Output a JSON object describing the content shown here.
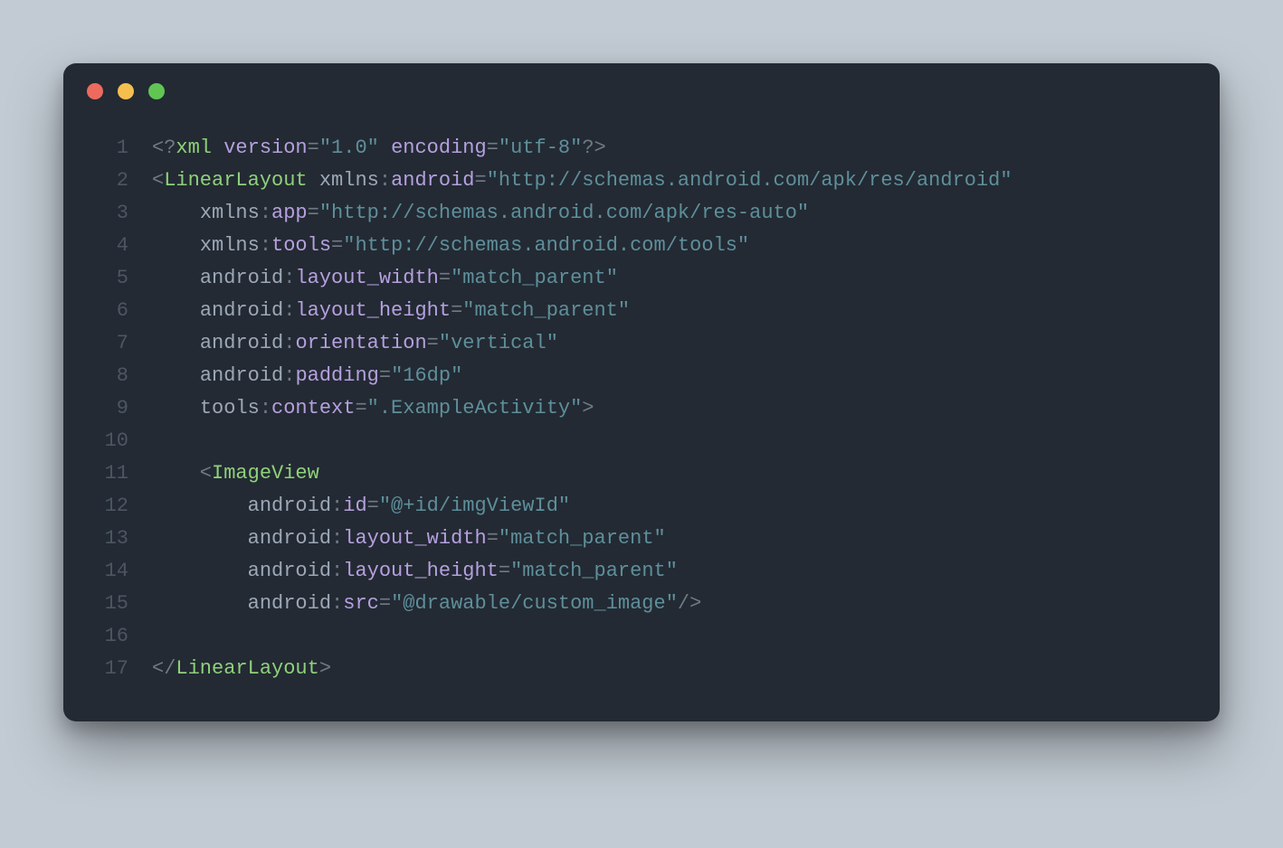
{
  "window": {
    "traffic_lights": [
      "red",
      "yellow",
      "green"
    ]
  },
  "code": {
    "lines": [
      {
        "n": "1",
        "tokens": [
          [
            "punc",
            "<?"
          ],
          [
            "tag",
            "xml"
          ],
          [
            "punc",
            " "
          ],
          [
            "attr",
            "version"
          ],
          [
            "punc",
            "="
          ],
          [
            "str",
            "\"1.0\""
          ],
          [
            "punc",
            " "
          ],
          [
            "attr",
            "encoding"
          ],
          [
            "punc",
            "="
          ],
          [
            "str",
            "\"utf-8\""
          ],
          [
            "punc",
            "?>"
          ]
        ]
      },
      {
        "n": "2",
        "tokens": [
          [
            "punc",
            "<"
          ],
          [
            "tag",
            "LinearLayout"
          ],
          [
            "punc",
            " "
          ],
          [
            "ns",
            "xmlns"
          ],
          [
            "punc",
            ":"
          ],
          [
            "attr",
            "android"
          ],
          [
            "punc",
            "="
          ],
          [
            "str",
            "\"http://schemas.android.com/apk/res/android\""
          ]
        ]
      },
      {
        "n": "3",
        "tokens": [
          [
            "punc",
            "    "
          ],
          [
            "ns",
            "xmlns"
          ],
          [
            "punc",
            ":"
          ],
          [
            "attr",
            "app"
          ],
          [
            "punc",
            "="
          ],
          [
            "str",
            "\"http://schemas.android.com/apk/res-auto\""
          ]
        ]
      },
      {
        "n": "4",
        "tokens": [
          [
            "punc",
            "    "
          ],
          [
            "ns",
            "xmlns"
          ],
          [
            "punc",
            ":"
          ],
          [
            "attr",
            "tools"
          ],
          [
            "punc",
            "="
          ],
          [
            "str",
            "\"http://schemas.android.com/tools\""
          ]
        ]
      },
      {
        "n": "5",
        "tokens": [
          [
            "punc",
            "    "
          ],
          [
            "ns",
            "android"
          ],
          [
            "punc",
            ":"
          ],
          [
            "attr",
            "layout_width"
          ],
          [
            "punc",
            "="
          ],
          [
            "str",
            "\"match_parent\""
          ]
        ]
      },
      {
        "n": "6",
        "tokens": [
          [
            "punc",
            "    "
          ],
          [
            "ns",
            "android"
          ],
          [
            "punc",
            ":"
          ],
          [
            "attr",
            "layout_height"
          ],
          [
            "punc",
            "="
          ],
          [
            "str",
            "\"match_parent\""
          ]
        ]
      },
      {
        "n": "7",
        "tokens": [
          [
            "punc",
            "    "
          ],
          [
            "ns",
            "android"
          ],
          [
            "punc",
            ":"
          ],
          [
            "attr",
            "orientation"
          ],
          [
            "punc",
            "="
          ],
          [
            "str",
            "\"vertical\""
          ]
        ]
      },
      {
        "n": "8",
        "tokens": [
          [
            "punc",
            "    "
          ],
          [
            "ns",
            "android"
          ],
          [
            "punc",
            ":"
          ],
          [
            "attr",
            "padding"
          ],
          [
            "punc",
            "="
          ],
          [
            "str",
            "\"16dp\""
          ]
        ]
      },
      {
        "n": "9",
        "tokens": [
          [
            "punc",
            "    "
          ],
          [
            "ns",
            "tools"
          ],
          [
            "punc",
            ":"
          ],
          [
            "attr",
            "context"
          ],
          [
            "punc",
            "="
          ],
          [
            "str",
            "\".ExampleActivity\""
          ],
          [
            "punc",
            ">"
          ]
        ]
      },
      {
        "n": "10",
        "tokens": []
      },
      {
        "n": "11",
        "tokens": [
          [
            "punc",
            "    <"
          ],
          [
            "tag",
            "ImageView"
          ]
        ]
      },
      {
        "n": "12",
        "tokens": [
          [
            "punc",
            "        "
          ],
          [
            "ns",
            "android"
          ],
          [
            "punc",
            ":"
          ],
          [
            "attr",
            "id"
          ],
          [
            "punc",
            "="
          ],
          [
            "str",
            "\"@+id/imgViewId\""
          ]
        ]
      },
      {
        "n": "13",
        "tokens": [
          [
            "punc",
            "        "
          ],
          [
            "ns",
            "android"
          ],
          [
            "punc",
            ":"
          ],
          [
            "attr",
            "layout_width"
          ],
          [
            "punc",
            "="
          ],
          [
            "str",
            "\"match_parent\""
          ]
        ]
      },
      {
        "n": "14",
        "tokens": [
          [
            "punc",
            "        "
          ],
          [
            "ns",
            "android"
          ],
          [
            "punc",
            ":"
          ],
          [
            "attr",
            "layout_height"
          ],
          [
            "punc",
            "="
          ],
          [
            "str",
            "\"match_parent\""
          ]
        ]
      },
      {
        "n": "15",
        "tokens": [
          [
            "punc",
            "        "
          ],
          [
            "ns",
            "android"
          ],
          [
            "punc",
            ":"
          ],
          [
            "attr",
            "src"
          ],
          [
            "punc",
            "="
          ],
          [
            "str",
            "\"@drawable/custom_image\""
          ],
          [
            "punc",
            "/>"
          ]
        ]
      },
      {
        "n": "16",
        "tokens": []
      },
      {
        "n": "17",
        "tokens": [
          [
            "punc",
            "</"
          ],
          [
            "tag",
            "LinearLayout"
          ],
          [
            "punc",
            ">"
          ]
        ]
      }
    ]
  }
}
